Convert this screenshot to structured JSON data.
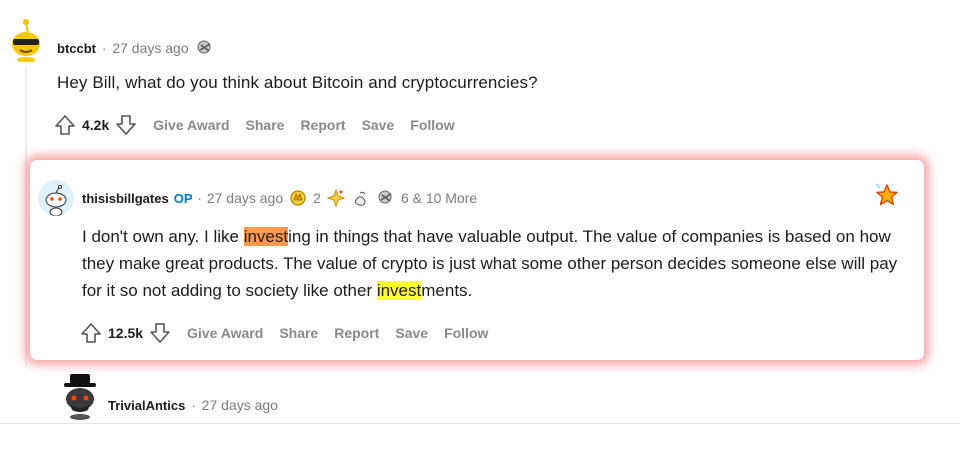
{
  "comments": [
    {
      "username": "btccbt",
      "time": "27 days ago",
      "body": "Hey Bill, what do you think about Bitcoin and cryptocurrencies?",
      "votes": "4.2k",
      "actions": [
        "Give Award",
        "Share",
        "Report",
        "Save",
        "Follow"
      ]
    },
    {
      "username": "thisisbillgates",
      "op": "OP",
      "time": "27 days ago",
      "award_count": "2",
      "more_awards": "6 & 10 More",
      "body_parts": [
        "I don't own any. I like ",
        "invest",
        "ing in things that have valuable output. The value of companies is based on how they make great products. The value of crypto is just what some other person decides someone else will pay for it so not adding to society like other ",
        "invest",
        "ments."
      ],
      "votes": "12.5k",
      "actions": [
        "Give Award",
        "Share",
        "Report",
        "Save",
        "Follow"
      ],
      "highlight_colors": {
        "orange": "#ff9a4d",
        "yellow": "#ffff33"
      }
    },
    {
      "username": "TrivialAntics",
      "time": "27 days ago"
    }
  ],
  "separator": "·",
  "icons": {
    "avatar1": "snoo-sunglasses-avatar",
    "avatar2": "snoo-avatar",
    "avatar3": "snoo-hat-avatar",
    "upvote": "arrow-up-icon",
    "downvote": "arrow-down-icon",
    "award": "award-icon",
    "star": "star-icon"
  },
  "colors": {
    "op": "#0079d3",
    "muted": "#878a8c",
    "card_glow": "#f05a5a"
  }
}
